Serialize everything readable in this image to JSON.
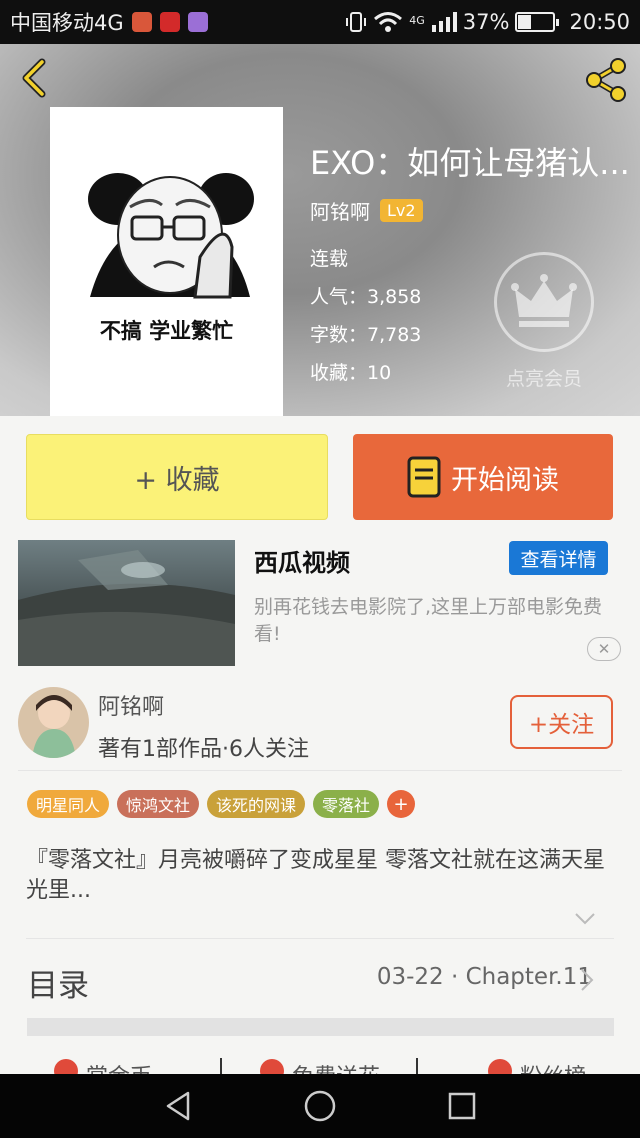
{
  "status_bar": {
    "carrier": "中国移动4G",
    "network": "4G",
    "battery": "37%",
    "battery_level": 0.37,
    "time": "20:50"
  },
  "book": {
    "title": "EXO：如何让母猪认...",
    "cover_caption": "不搞 学业繁忙",
    "author": "阿铭啊",
    "level": "Lv2",
    "status": "连载",
    "popularity": "人气：3,858",
    "word_count": "字数：7,783",
    "favorites": "收藏：10"
  },
  "vip": {
    "label": "点亮会员"
  },
  "actions": {
    "favorite_label": "+ 收藏",
    "read_label": "开始阅读"
  },
  "ad": {
    "title": "西瓜视频",
    "button": "查看详情",
    "description": "别再花钱去电影院了,这里上万部电影免费看!",
    "close": "✕"
  },
  "author_card": {
    "name": "阿铭啊",
    "stats": "著有1部作品·6人关注",
    "follow": "+关注"
  },
  "tags": [
    {
      "label": "明星同人",
      "color": "#f0a93c"
    },
    {
      "label": "惊鸿文社",
      "color": "#c9705a"
    },
    {
      "label": "该死的网课",
      "color": "#c9a13a"
    },
    {
      "label": "零落社",
      "color": "#8bb04a"
    }
  ],
  "tag_add": "+",
  "description": "『零落文社』月亮被嚼碎了变成星星 零落文社就在这满天星光里...",
  "toc": {
    "label": "目录",
    "latest": "03-22 · Chapter.11"
  },
  "bottom_tabs": [
    {
      "label": "赏金币",
      "color": "#e04a3a"
    },
    {
      "label": "免费送花",
      "color": "#e04a3a"
    },
    {
      "label": "粉丝榜",
      "color": "#e04a3a"
    }
  ],
  "colors": {
    "accent_orange": "#e8683b",
    "favorite_yellow": "#fbf278",
    "ad_blue": "#1a78d6",
    "level_badge": "#f2b533"
  }
}
